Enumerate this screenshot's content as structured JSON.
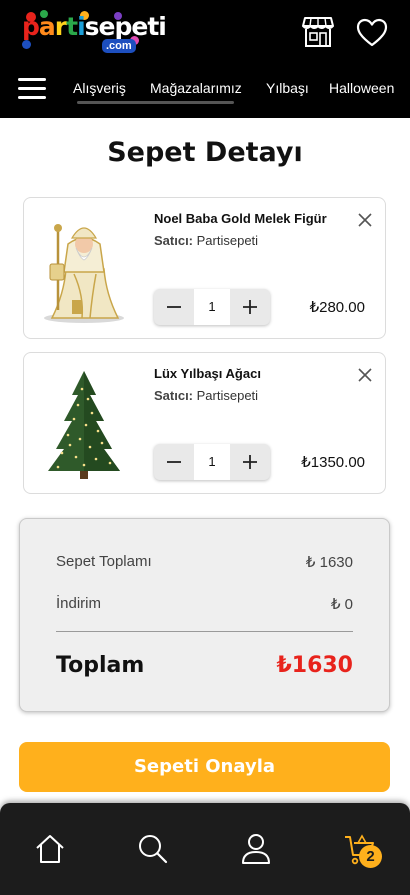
{
  "header": {
    "logo": {
      "text": "partisepeti",
      "suffix": ".com"
    },
    "nav": [
      {
        "label": "Alışveriş"
      },
      {
        "label": "Mağazalarımız"
      },
      {
        "label": "Yılbaşı"
      },
      {
        "label": "Halloween"
      }
    ],
    "icons": [
      "store-icon",
      "heart-icon",
      "menu-icon"
    ]
  },
  "page": {
    "title": "Sepet Detayı"
  },
  "cart": {
    "items": [
      {
        "name": "Noel Baba Gold Melek Figür",
        "seller_label": "Satıcı:",
        "seller": "Partisepeti",
        "quantity": "1",
        "price": "₺280.00"
      },
      {
        "name": "Lüx Yılbaşı Ağacı",
        "seller_label": "Satıcı:",
        "seller": "Partisepeti",
        "quantity": "1",
        "price": "₺1350.00"
      }
    ]
  },
  "summary": {
    "subtotal_label": "Sepet Toplamı",
    "subtotal_value": "₺ 1630",
    "discount_label": "İndirim",
    "discount_value": "₺ 0",
    "total_label": "Toplam",
    "total_value": "₺1630"
  },
  "actions": {
    "confirm_label": "Sepeti Onayla"
  },
  "tabbar": {
    "tabs": [
      "home-icon",
      "search-icon",
      "user-icon",
      "cart-icon"
    ],
    "cart_count": "2"
  },
  "colors": {
    "accent": "#ffb01c",
    "total_red": "#e8231c",
    "header_bg": "#000000",
    "tabbar_bg": "#1c1c1c"
  }
}
